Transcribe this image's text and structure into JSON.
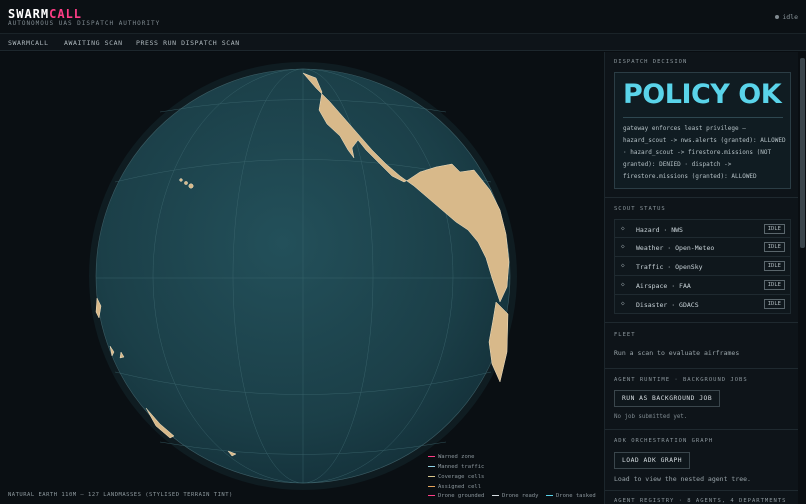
{
  "app": {
    "logo_a": "SWARM",
    "logo_b": "CALL",
    "subtitle": "AUTONOMOUS UAS DISPATCH AUTHORITY",
    "status": "idle"
  },
  "nav": [
    "SWARMCALL",
    "AWAITING SCAN",
    "PRESS RUN DISPATCH SCAN"
  ],
  "map": {
    "caption": "NATURAL EARTH 110M — 127 LANDMASSES (STYLISED TERRAIN TINT)",
    "legend": [
      {
        "label": "Warned zone",
        "color": "#ff3d86"
      },
      {
        "label": "Manned traffic",
        "color": "#8fd3e8"
      },
      {
        "label": "Coverage cells",
        "color": "#d8c58a"
      },
      {
        "label": "Assigned cell",
        "color": "#e8a45a"
      },
      {
        "label": "Drone grounded",
        "color": "#ff3d86"
      },
      {
        "label": "Drone ready",
        "color": "#d6dde1"
      },
      {
        "label": "Drone tasked",
        "color": "#5ad4ea"
      }
    ],
    "ocean_color": "#1b3c45",
    "land_color": "#d8b98a"
  },
  "sidebar": {
    "dispatch": {
      "title": "DISPATCH DECISION",
      "verdict": "POLICY OK",
      "details": "gateway enforces least privilege — hazard_scout -> nws.alerts (granted): ALLOWED · hazard_scout -> firestore.missions (NOT granted): DENIED · dispatch -> firestore.missions (granted): ALLOWED",
      "accent": "#5ad4ea"
    },
    "scouts": {
      "title": "SCOUT STATUS",
      "items": [
        {
          "name": "Hazard · NWS",
          "status": "IDLE",
          "icon": "diamond-icon"
        },
        {
          "name": "Weather · Open-Meteo",
          "status": "IDLE",
          "icon": "diamond-icon"
        },
        {
          "name": "Traffic · OpenSky",
          "status": "IDLE",
          "icon": "diamond-icon"
        },
        {
          "name": "Airspace · FAA",
          "status": "IDLE",
          "icon": "diamond-icon"
        },
        {
          "name": "Disaster · GDACS",
          "status": "IDLE",
          "icon": "diamond-icon"
        }
      ]
    },
    "fleet": {
      "title": "FLEET",
      "message": "Run a scan to evaluate airframes"
    },
    "runtime": {
      "title": "AGENT RUNTIME · BACKGROUND JOBS",
      "button": "RUN AS BACKGROUND JOB",
      "note": "No job submitted yet."
    },
    "adk": {
      "title": "ADK ORCHESTRATION GRAPH",
      "button": "LOAD ADK GRAPH",
      "note": "Load to view the nested agent tree."
    },
    "registry": {
      "title": "AGENT REGISTRY · 8 AGENTS, 4 DEPARTMENTS"
    }
  }
}
